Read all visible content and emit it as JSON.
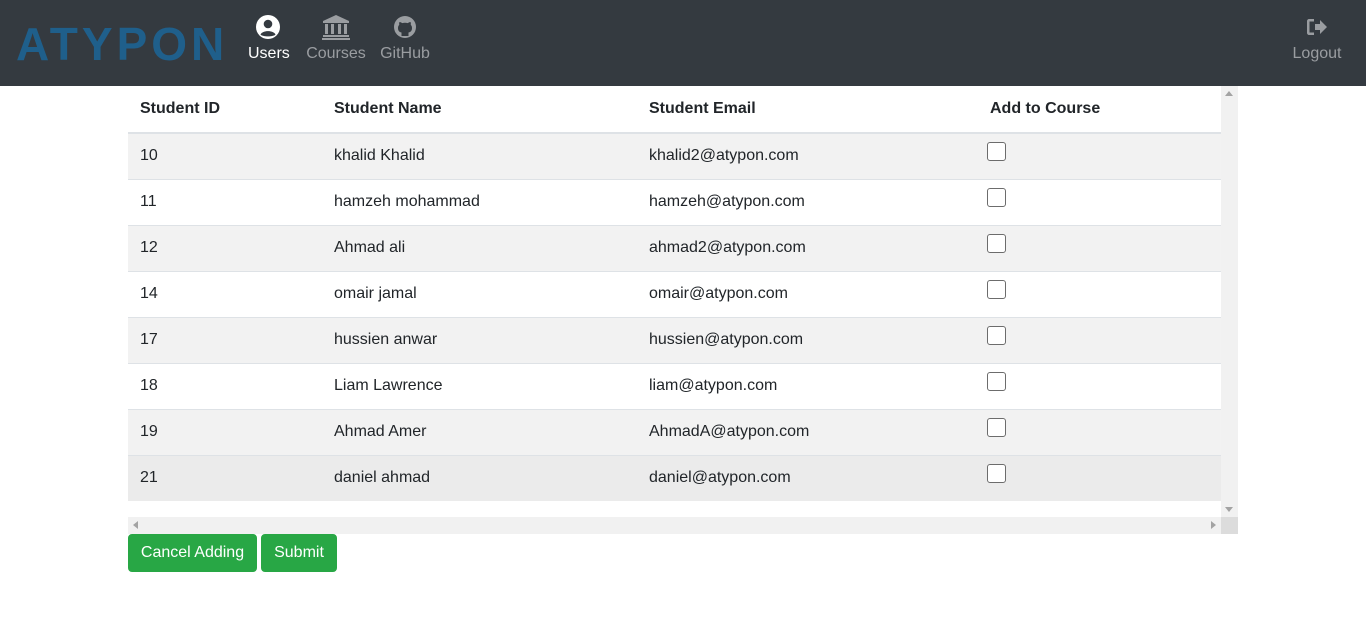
{
  "brand": {
    "logo_text": "ATYPON",
    "logo_color": "#1f5f8b"
  },
  "nav": {
    "users": {
      "label": "Users",
      "icon": "user-circle-icon"
    },
    "courses": {
      "label": "Courses",
      "icon": "university-icon"
    },
    "github": {
      "label": "GitHub",
      "icon": "github-icon"
    },
    "logout": {
      "label": "Logout",
      "icon": "sign-out-icon"
    }
  },
  "table": {
    "headers": {
      "id": "Student ID",
      "name": "Student Name",
      "email": "Student Email",
      "add": "Add to Course"
    },
    "rows": [
      {
        "id": "10",
        "name": "khalid Khalid",
        "email": "khalid2@atypon.com",
        "checked": false
      },
      {
        "id": "11",
        "name": "hamzeh mohammad",
        "email": "hamzeh@atypon.com",
        "checked": false
      },
      {
        "id": "12",
        "name": "Ahmad ali",
        "email": "ahmad2@atypon.com",
        "checked": false
      },
      {
        "id": "14",
        "name": "omair jamal",
        "email": "omair@atypon.com",
        "checked": false
      },
      {
        "id": "17",
        "name": "hussien anwar",
        "email": "hussien@atypon.com",
        "checked": false
      },
      {
        "id": "18",
        "name": "Liam Lawrence",
        "email": "liam@atypon.com",
        "checked": false
      },
      {
        "id": "19",
        "name": "Ahmad Amer",
        "email": "AhmadA@atypon.com",
        "checked": false
      },
      {
        "id": "21",
        "name": "daniel ahmad",
        "email": "daniel@atypon.com",
        "checked": false
      }
    ]
  },
  "actions": {
    "cancel_label": "Cancel Adding",
    "submit_label": "Submit",
    "button_color": "#28a745"
  }
}
